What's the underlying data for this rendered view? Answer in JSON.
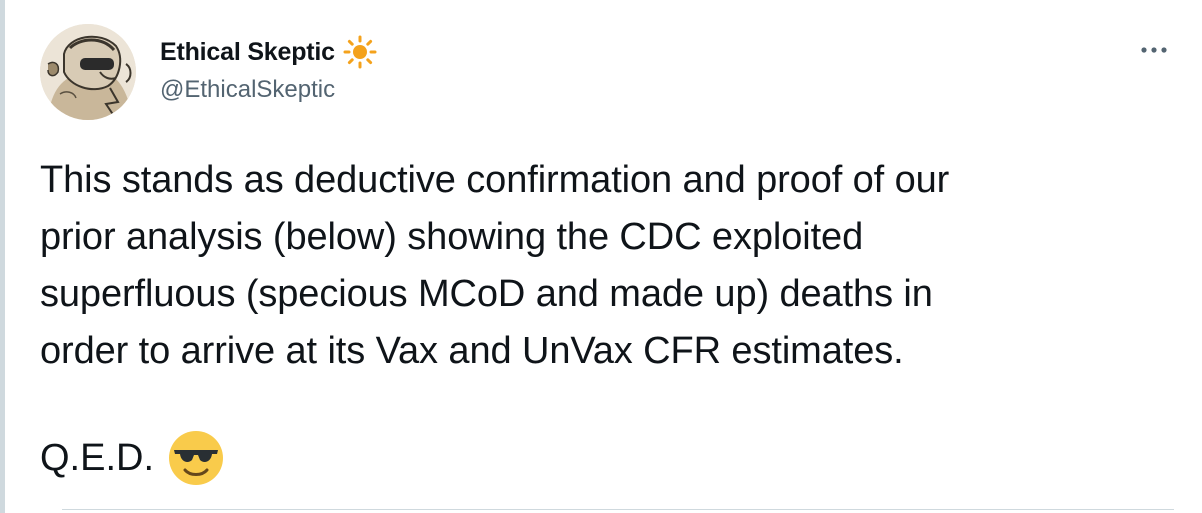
{
  "author": {
    "display_name": "Ethical Skeptic",
    "handle": "@EthicalSkeptic",
    "name_emoji": "sun-icon",
    "avatar": "avatar-illustration"
  },
  "tweet": {
    "lines": [
      "This stands as deductive confirmation and proof of our",
      "prior analysis (below) showing the CDC exploited",
      "superfluous (specious MCoD and made up) deaths in",
      "order to arrive at its Vax and UnVax CFR estimates."
    ],
    "sign_off": "Q.E.D.",
    "sign_off_emoji": "smiling-face-with-sunglasses-icon"
  },
  "colors": {
    "text": "#0f1419",
    "secondary_text": "#536471",
    "sun": "#f4a21c",
    "emoji_face": "#f9cb4b",
    "border": "#cfd9de"
  }
}
